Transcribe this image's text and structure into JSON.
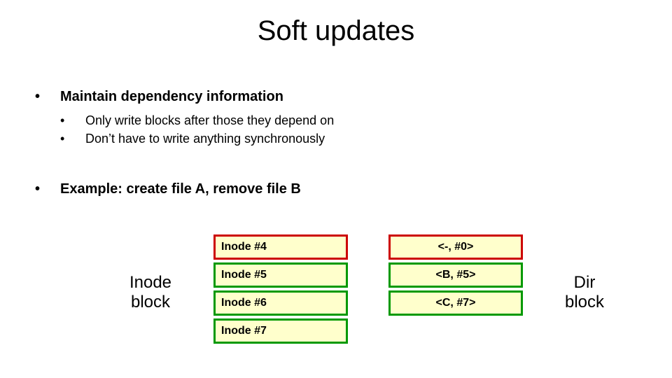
{
  "title": "Soft updates",
  "bullets": {
    "b1a": "Maintain dependency information",
    "b2a": "Only write blocks after those they depend on",
    "b2b": "Don’t have to write anything synchronously",
    "b1b": "Example: create file A, remove file B"
  },
  "labels": {
    "inode_block_l1": "Inode",
    "inode_block_l2": "block",
    "dir_block_l1": "Dir",
    "dir_block_l2": "block"
  },
  "inode_cells": [
    {
      "text": "Inode #4",
      "border": "red"
    },
    {
      "text": "Inode #5",
      "border": "green"
    },
    {
      "text": "Inode #6",
      "border": "green"
    },
    {
      "text": "Inode #7",
      "border": "green"
    }
  ],
  "dir_cells": [
    {
      "text": "<-, #0>",
      "border": "red"
    },
    {
      "text": "<B, #5>",
      "border": "green"
    },
    {
      "text": "<C, #7>",
      "border": "green"
    }
  ]
}
